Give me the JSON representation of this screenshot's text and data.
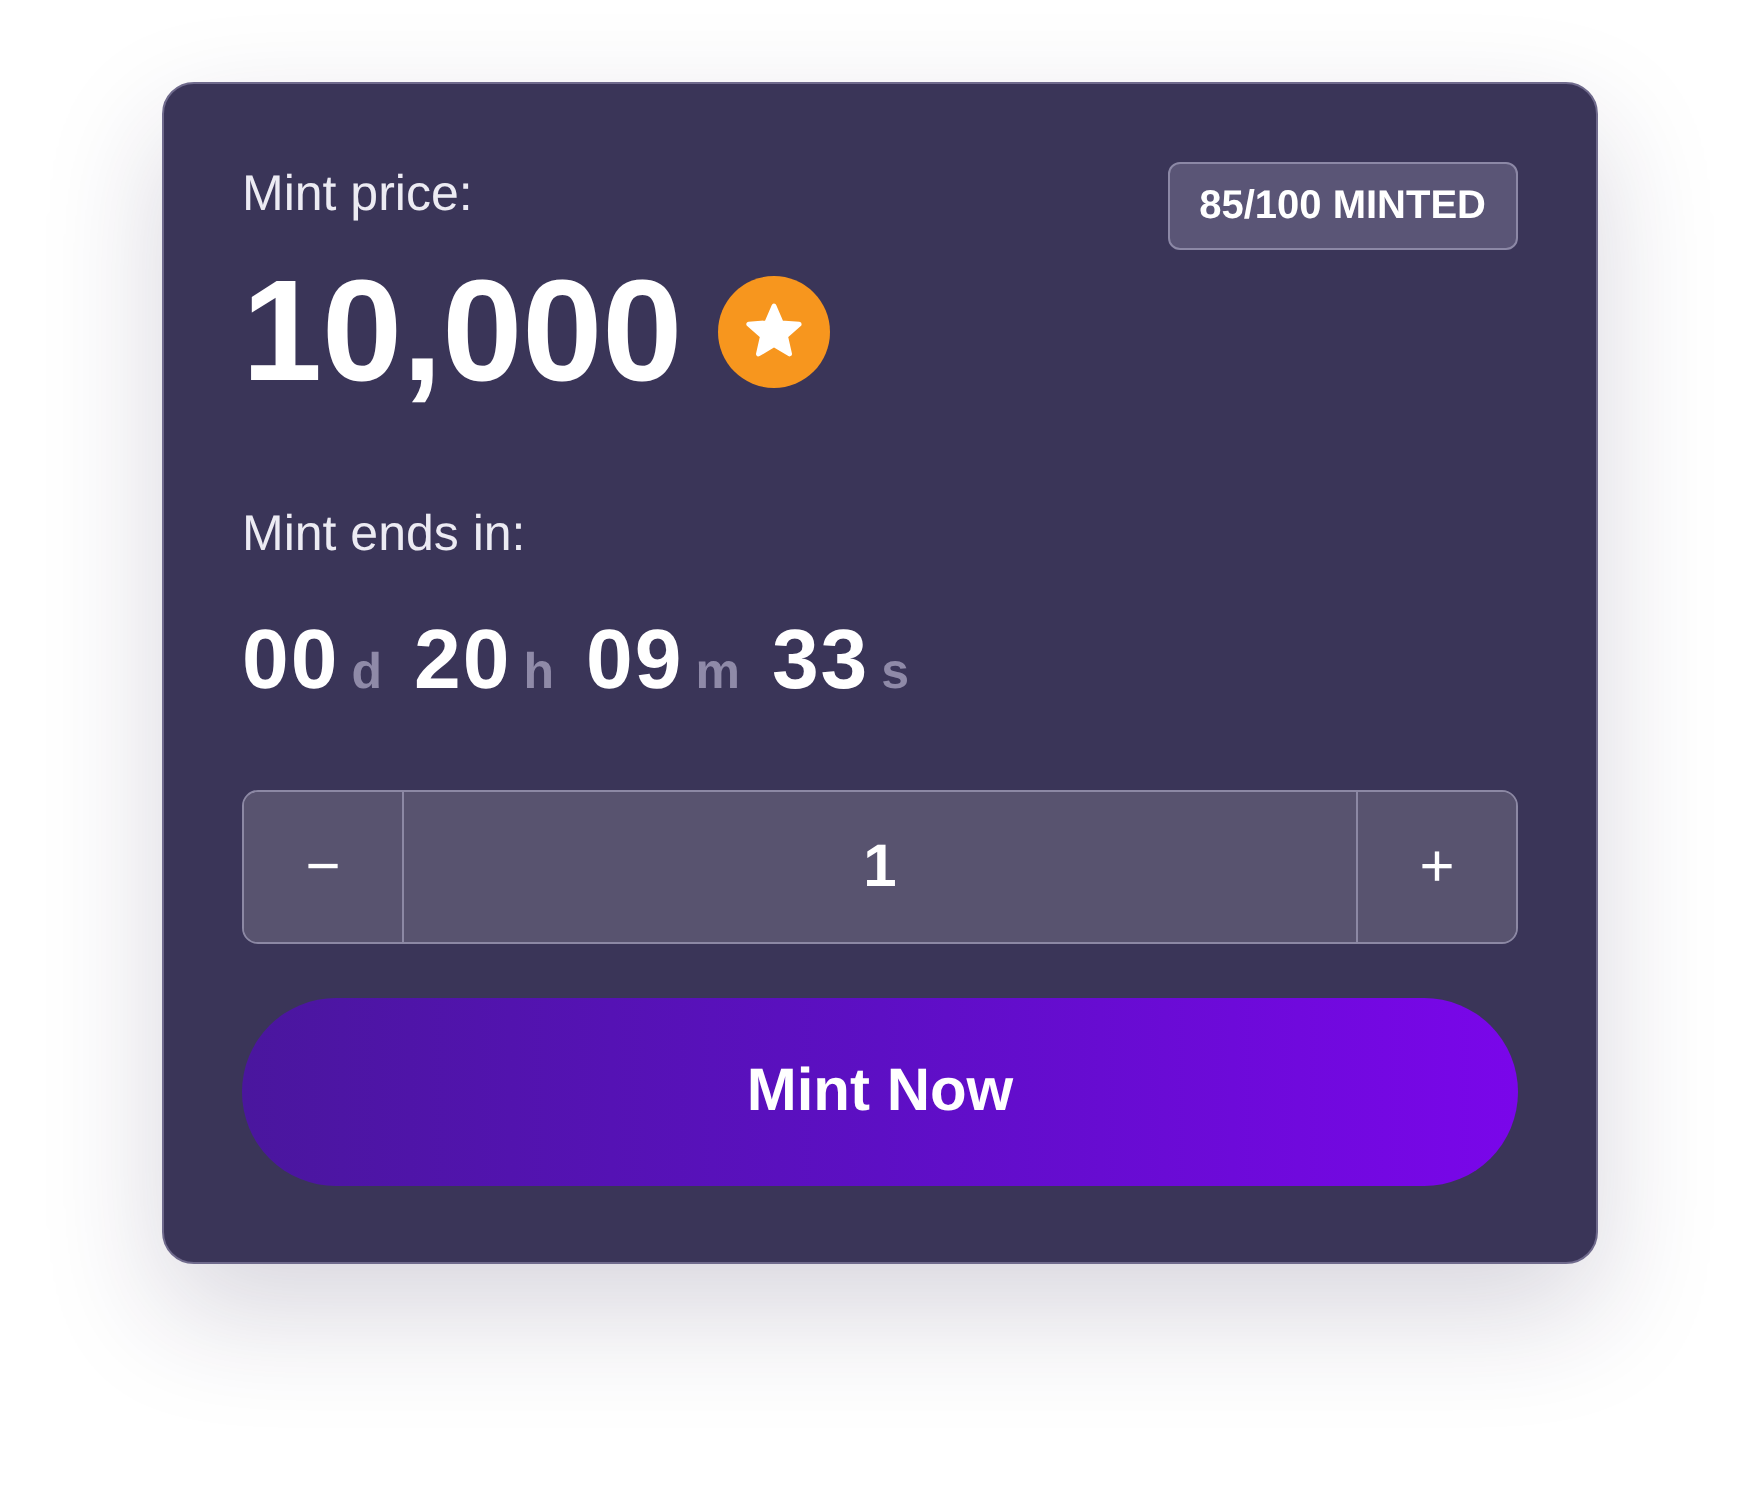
{
  "price": {
    "label": "Mint price:",
    "amount": "10,000"
  },
  "badge": {
    "text": "85/100 MINTED"
  },
  "countdown": {
    "label": "Mint ends in:",
    "parts": [
      {
        "value": "00",
        "unit": "d"
      },
      {
        "value": "20",
        "unit": "h"
      },
      {
        "value": "09",
        "unit": "m"
      },
      {
        "value": "33",
        "unit": "s"
      }
    ]
  },
  "quantity": {
    "decrement": "−",
    "value": "1",
    "increment": "+"
  },
  "button": {
    "label": "Mint Now"
  }
}
